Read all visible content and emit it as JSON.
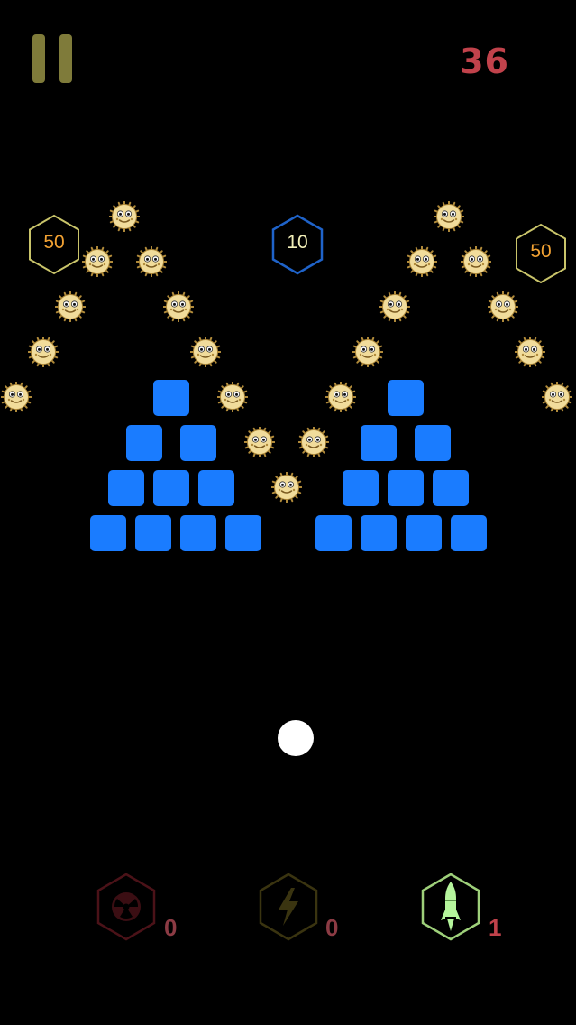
{
  "colors": {
    "pause": "#7f7b3a",
    "score": "#c1424b",
    "brick": "#1a7cff",
    "hex_gold": "#c9c46a",
    "hex_gold_text": "#f2a233",
    "hex_blue": "#1f63c9",
    "hex_blue_text": "#f2efb8",
    "ball": "#ffffff",
    "count_dim": "#8c3b44",
    "count": "#c1424b",
    "radiation_frame": "#4b1218",
    "lightning_frame": "#3a3410",
    "missile_frame": "#9ed07a",
    "missile_fill": "#b5f59c",
    "creature_body": "#f1dc9b",
    "creature_fur": "#b08a3a"
  },
  "hud": {
    "pause_icon": "pause-icon",
    "score": "36"
  },
  "bonus_hexes": [
    {
      "value": "50",
      "style": "gold"
    },
    {
      "value": "10",
      "style": "blue"
    },
    {
      "value": "50",
      "style": "gold"
    }
  ],
  "brick_pyramids": [
    {
      "rows": [
        1,
        2,
        3,
        4
      ]
    },
    {
      "rows": [
        1,
        2,
        3,
        4
      ]
    }
  ],
  "creatures": {
    "count": 21,
    "icon": "fuzzy-creature-icon"
  },
  "ball": {
    "icon": "ball"
  },
  "powerups": [
    {
      "name": "radiation",
      "icon": "radiation-icon",
      "count": "0"
    },
    {
      "name": "lightning",
      "icon": "lightning-icon",
      "count": "0"
    },
    {
      "name": "missile",
      "icon": "missile-icon",
      "count": "1"
    }
  ]
}
